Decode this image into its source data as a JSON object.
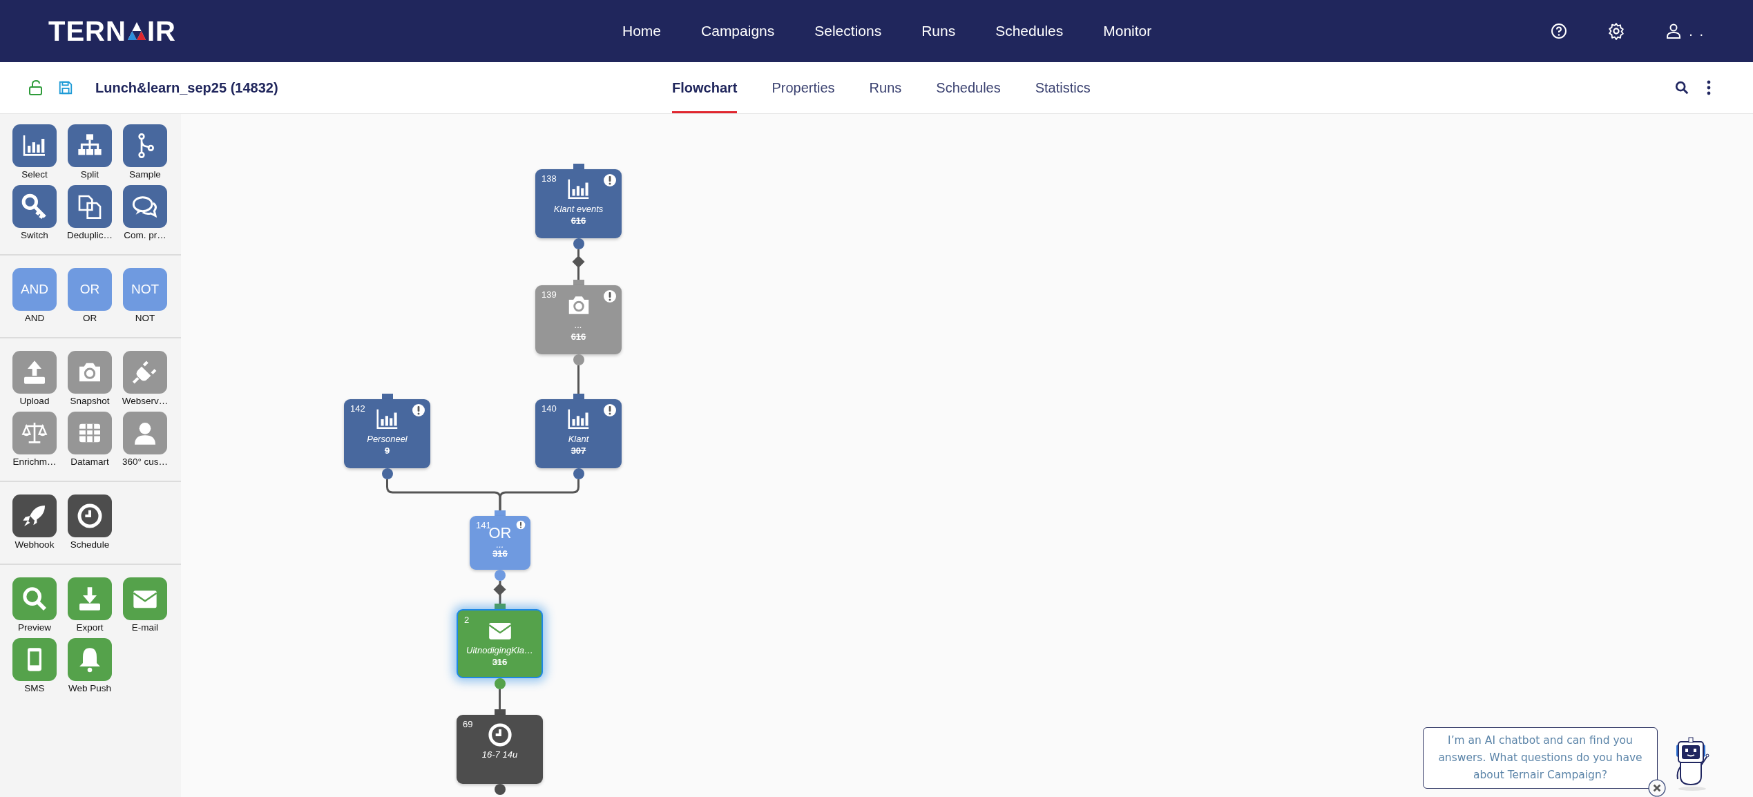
{
  "header": {
    "logo": [
      "TERN",
      "IR"
    ],
    "nav": [
      {
        "label": "Home",
        "selected": false
      },
      {
        "label": "Campaigns",
        "selected": false
      },
      {
        "label": "Selections",
        "selected": false
      },
      {
        "label": "Runs",
        "selected": false
      },
      {
        "label": "Schedules",
        "selected": false
      },
      {
        "label": "Monitor",
        "selected": false
      }
    ],
    "user_label": ". ."
  },
  "toolbar": {
    "title": "Lunch&learn_sep25 (14832)",
    "tabs": [
      {
        "label": "Flowchart",
        "selected": true
      },
      {
        "label": "Properties",
        "selected": false
      },
      {
        "label": "Runs",
        "selected": false
      },
      {
        "label": "Schedules",
        "selected": false
      },
      {
        "label": "Statistics",
        "selected": false
      }
    ]
  },
  "palette": [
    {
      "kind": "data",
      "items": [
        {
          "label": "Select",
          "kind": "select"
        },
        {
          "label": "Split",
          "kind": "split"
        },
        {
          "label": "Sample",
          "kind": "sample"
        },
        {
          "label": "Switch",
          "kind": "switch"
        },
        {
          "label": "Deduplic…",
          "kind": "dedup"
        },
        {
          "label": "Com. pr…",
          "kind": "compr"
        }
      ]
    },
    {
      "kind": "logic",
      "items": [
        {
          "label": "AND",
          "kind": "text",
          "tile_text": "AND"
        },
        {
          "label": "OR",
          "kind": "text",
          "tile_text": "OR"
        },
        {
          "label": "NOT",
          "kind": "text",
          "tile_text": "NOT"
        }
      ]
    },
    {
      "kind": "source",
      "items": [
        {
          "label": "Upload",
          "kind": "upload"
        },
        {
          "label": "Snapshot",
          "kind": "snapshot"
        },
        {
          "label": "Webserv…",
          "kind": "plug"
        },
        {
          "label": "Enrichm…",
          "kind": "scales"
        },
        {
          "label": "Datamart",
          "kind": "grid"
        },
        {
          "label": "360° cus…",
          "kind": "person"
        }
      ]
    },
    {
      "kind": "trigger",
      "items": [
        {
          "label": "Webhook",
          "kind": "rocket"
        },
        {
          "label": "Schedule",
          "kind": "clock"
        }
      ]
    },
    {
      "kind": "output",
      "items": [
        {
          "label": "Preview",
          "kind": "search"
        },
        {
          "label": "Export",
          "kind": "download"
        },
        {
          "label": "E-mail",
          "kind": "mail"
        },
        {
          "label": "SMS",
          "kind": "phone"
        },
        {
          "label": "Web Push",
          "kind": "bell"
        }
      ]
    }
  ],
  "nodes": [
    {
      "number": "138",
      "kind": "select",
      "name": "Klant events",
      "count": "616",
      "alert": true,
      "selected": false
    },
    {
      "number": "139",
      "kind": "snapshot",
      "name": "...",
      "count": "616",
      "alert": true,
      "selected": false
    },
    {
      "number": "142",
      "kind": "select",
      "name": "Personeel",
      "count": "9",
      "alert": true,
      "selected": false
    },
    {
      "number": "140",
      "kind": "select",
      "name": "Klant",
      "count": "307",
      "alert": true,
      "selected": false
    },
    {
      "number": "141",
      "kind": "or",
      "tile_text": "OR",
      "name": "...",
      "count": "316",
      "alert": true,
      "selected": false
    },
    {
      "number": "2",
      "kind": "mail",
      "name": "UitnodigingKla…",
      "count": "316",
      "alert": false,
      "selected": true
    },
    {
      "number": "69",
      "kind": "clock",
      "name": "16-7 14u",
      "alert": false,
      "selected": false
    }
  ],
  "chatbot": {
    "message": "I’m an AI chatbot and can find you answers. What questions do you have about Ternair Campaign?"
  }
}
